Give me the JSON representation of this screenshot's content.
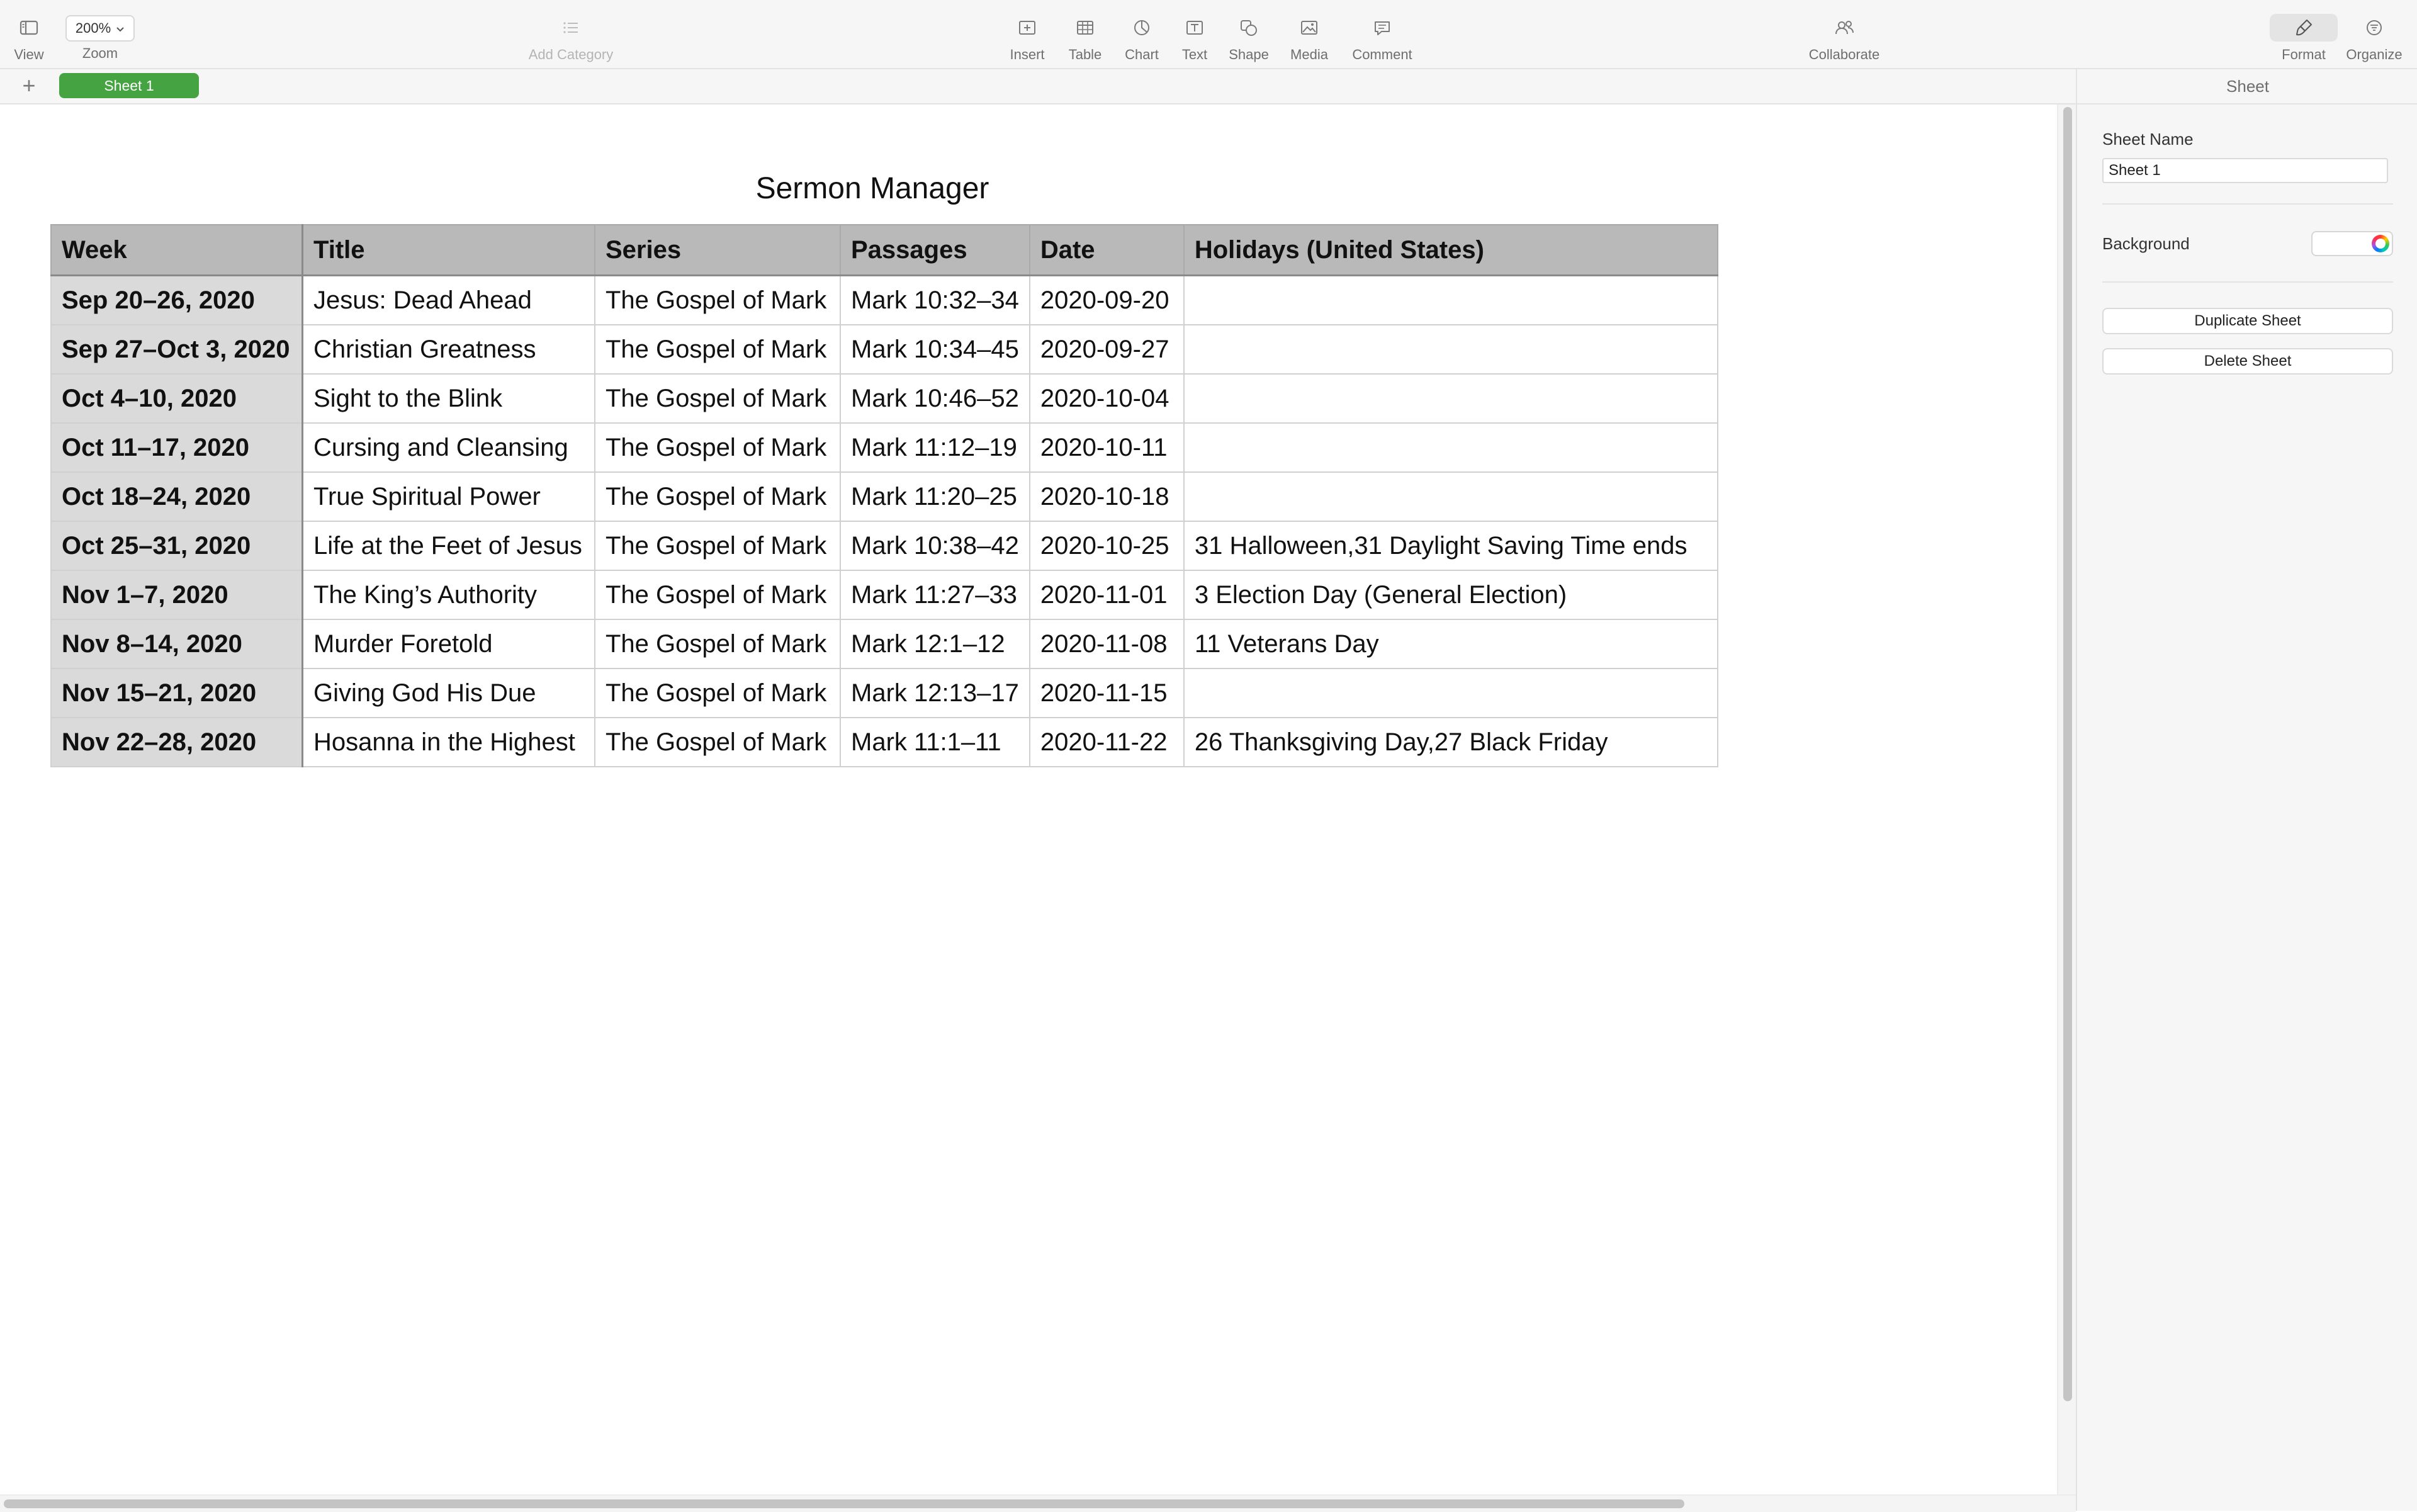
{
  "toolbar": {
    "view_label": "View",
    "zoom_value": "200%",
    "zoom_label": "Zoom",
    "add_category_label": "Add Category",
    "insert_label": "Insert",
    "table_label": "Table",
    "chart_label": "Chart",
    "text_label": "Text",
    "shape_label": "Shape",
    "media_label": "Media",
    "comment_label": "Comment",
    "collaborate_label": "Collaborate",
    "format_label": "Format",
    "organize_label": "Organize"
  },
  "tabs": {
    "add_symbol": "+",
    "active_sheet": "Sheet 1",
    "active_color": "#45a441"
  },
  "table": {
    "title": "Sermon Manager",
    "headers": [
      "Week",
      "Title",
      "Series",
      "Passages",
      "Date",
      "Holidays (United States)"
    ],
    "rows": [
      [
        "Sep 20–26, 2020",
        "Jesus: Dead Ahead",
        "The Gospel of Mark",
        "Mark 10:32–34",
        "2020-09-20",
        ""
      ],
      [
        "Sep 27–Oct 3, 2020",
        "Christian Greatness",
        "The Gospel of Mark",
        "Mark 10:34–45",
        "2020-09-27",
        ""
      ],
      [
        "Oct 4–10, 2020",
        "Sight to the Blink",
        "The Gospel of Mark",
        "Mark 10:46–52",
        "2020-10-04",
        ""
      ],
      [
        "Oct 11–17, 2020",
        "Cursing and Cleansing",
        "The Gospel of Mark",
        "Mark 11:12–19",
        "2020-10-11",
        ""
      ],
      [
        "Oct 18–24, 2020",
        "True Spiritual Power",
        "The Gospel of Mark",
        "Mark 11:20–25",
        "2020-10-18",
        ""
      ],
      [
        "Oct 25–31, 2020",
        "Life at the Feet of Jesus",
        "The Gospel of Mark",
        "Mark 10:38–42",
        "2020-10-25",
        "31 Halloween,31 Daylight Saving Time ends"
      ],
      [
        "Nov 1–7, 2020",
        "The King’s Authority",
        "The Gospel of Mark",
        "Mark 11:27–33",
        "2020-11-01",
        "3 Election Day (General Election)"
      ],
      [
        "Nov 8–14, 2020",
        "Murder Foretold",
        "The Gospel of Mark",
        "Mark 12:1–12",
        "2020-11-08",
        "11 Veterans Day"
      ],
      [
        "Nov 15–21, 2020",
        "Giving God His Due",
        "The Gospel of Mark",
        "Mark 12:13–17",
        "2020-11-15",
        ""
      ],
      [
        "Nov 22–28, 2020",
        "Hosanna in the Highest",
        "The Gospel of Mark",
        "Mark 11:1–11",
        "2020-11-22",
        "26 Thanksgiving Day,27 Black Friday"
      ]
    ]
  },
  "inspector": {
    "header": "Sheet",
    "sheet_name_label": "Sheet Name",
    "sheet_name_value": "Sheet 1",
    "background_label": "Background",
    "duplicate_label": "Duplicate Sheet",
    "delete_label": "Delete Sheet"
  }
}
